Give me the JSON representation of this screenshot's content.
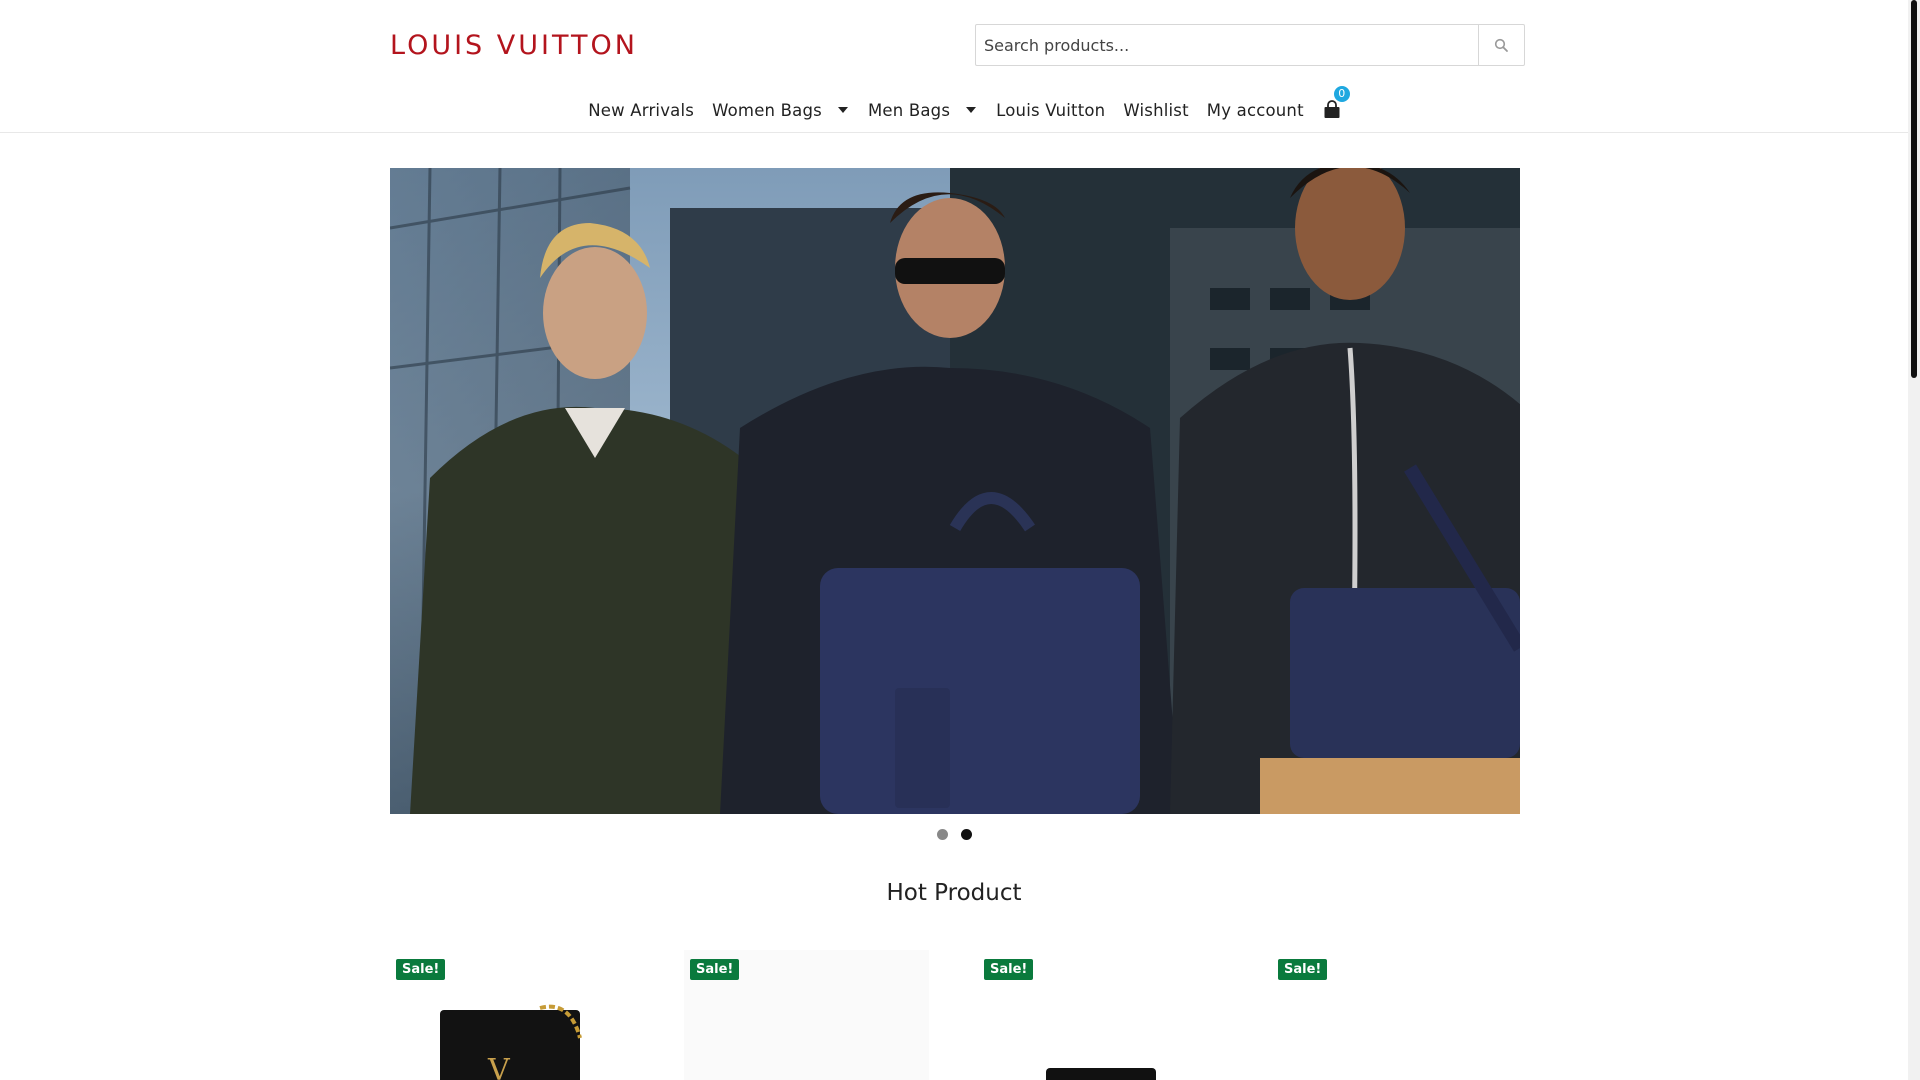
{
  "brand": {
    "logo_text": "LOUIS VUITTON",
    "color": "#b3141d"
  },
  "search": {
    "placeholder": "Search products...",
    "icon": "search-icon"
  },
  "nav": {
    "items": [
      {
        "label": "New Arrivals",
        "dropdown": false
      },
      {
        "label": "Women Bags",
        "dropdown": true
      },
      {
        "label": "Men Bags",
        "dropdown": true
      },
      {
        "label": "Louis Vuitton",
        "dropdown": false
      },
      {
        "label": "Wishlist",
        "dropdown": false
      },
      {
        "label": "My account",
        "dropdown": false
      }
    ],
    "cart": {
      "icon": "shopping-bag-icon",
      "count": "0",
      "badge_color": "#1fa8e0"
    }
  },
  "slider": {
    "slide_count": 2,
    "active_index": 1
  },
  "hot_product": {
    "title": "Hot Product",
    "products": [
      {
        "badge": "Sale!",
        "image": "black-chain-bag"
      },
      {
        "badge": "Sale!",
        "image": "light-product"
      },
      {
        "badge": "Sale!",
        "image": "black-wallet"
      },
      {
        "badge": "Sale!",
        "image": "white-product"
      }
    ],
    "badge_color": "#0a7a3d"
  }
}
